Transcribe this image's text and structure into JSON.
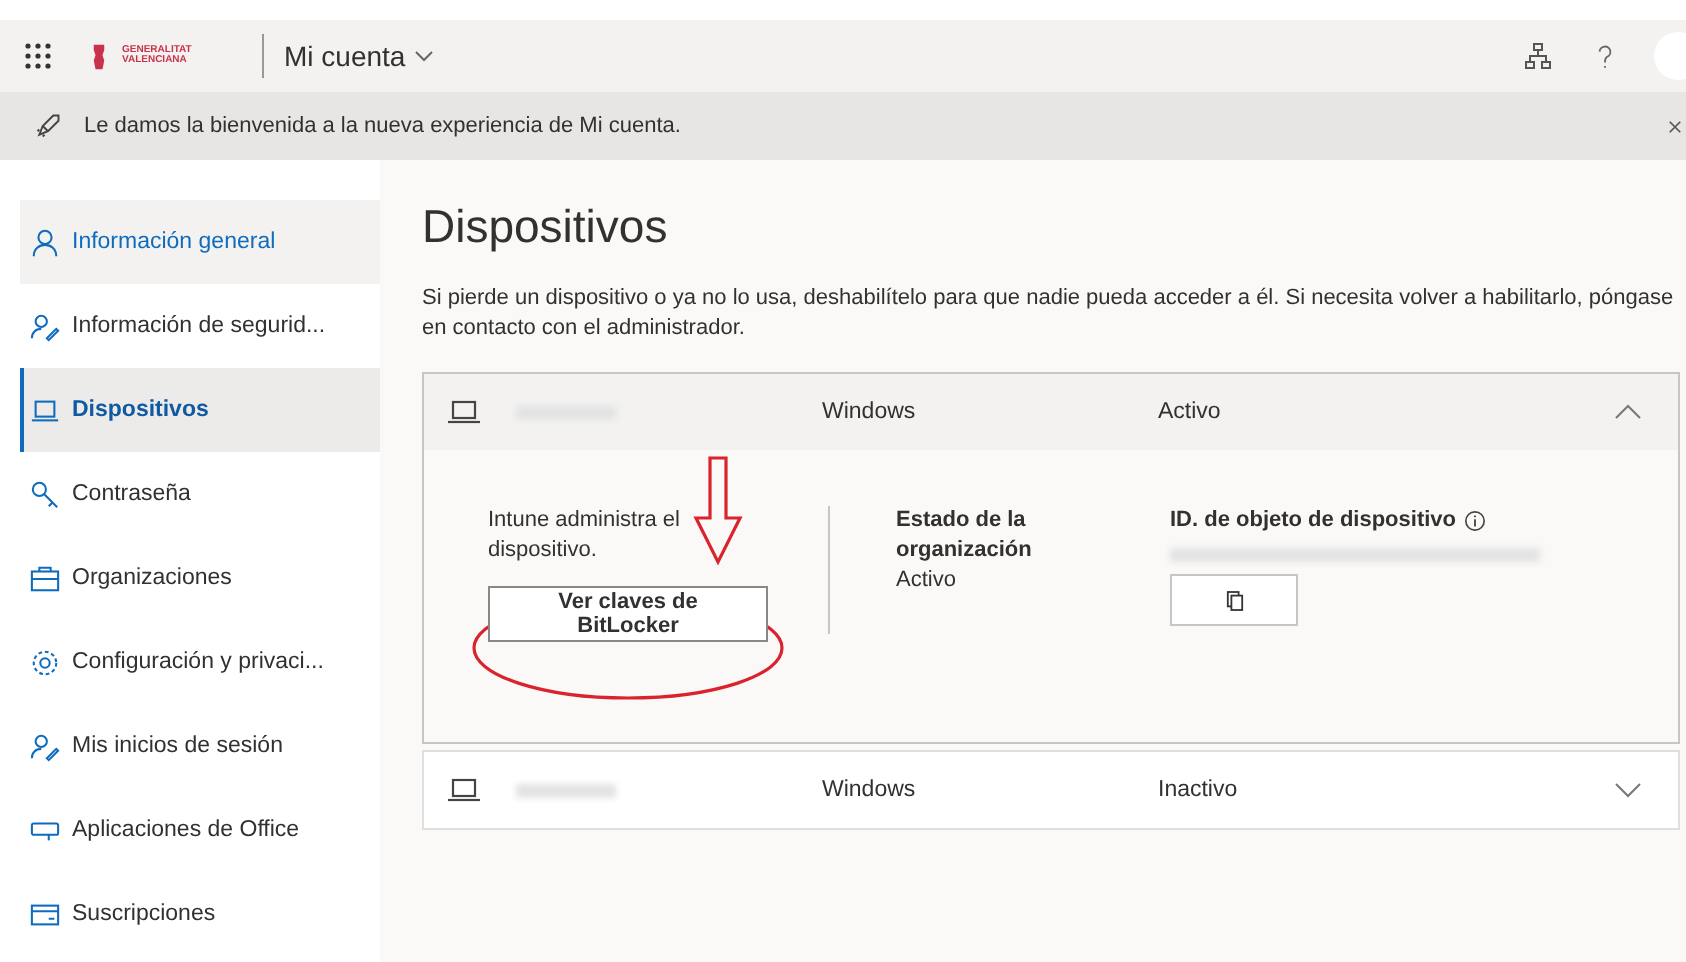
{
  "header": {
    "logo_text": "GENERALITAT VALENCIANA",
    "title": "Mi cuenta"
  },
  "banner": {
    "text": "Le damos la bienvenida a la nueva experiencia de Mi cuenta."
  },
  "sidebar": {
    "items": [
      {
        "label": "Información general",
        "selected": false,
        "hovered": true
      },
      {
        "label": "Información de segurid...",
        "selected": false,
        "hovered": false
      },
      {
        "label": "Dispositivos",
        "selected": true,
        "hovered": false
      },
      {
        "label": "Contraseña",
        "selected": false,
        "hovered": false
      },
      {
        "label": "Organizaciones",
        "selected": false,
        "hovered": false
      },
      {
        "label": "Configuración y privaci...",
        "selected": false,
        "hovered": false
      },
      {
        "label": "Mis inicios de sesión",
        "selected": false,
        "hovered": false
      },
      {
        "label": "Aplicaciones de Office",
        "selected": false,
        "hovered": false
      },
      {
        "label": "Suscripciones",
        "selected": false,
        "hovered": false
      }
    ]
  },
  "page": {
    "title": "Dispositivos",
    "description": "Si pierde un dispositivo o ya no lo usa, deshabilítelo para que nadie pueda acceder a él. Si necesita volver a habilitarlo, póngase en contacto con el administrador."
  },
  "devices": [
    {
      "os": "Windows",
      "status": "Activo",
      "expanded": true,
      "details": {
        "managed_text": "Intune administra el dispositivo.",
        "button": "Ver claves de BitLocker",
        "org_label": "Estado de la organización",
        "org_value": "Activo",
        "id_label": "ID. de objeto de dispositivo"
      }
    },
    {
      "os": "Windows",
      "status": "Inactivo",
      "expanded": false
    }
  ]
}
